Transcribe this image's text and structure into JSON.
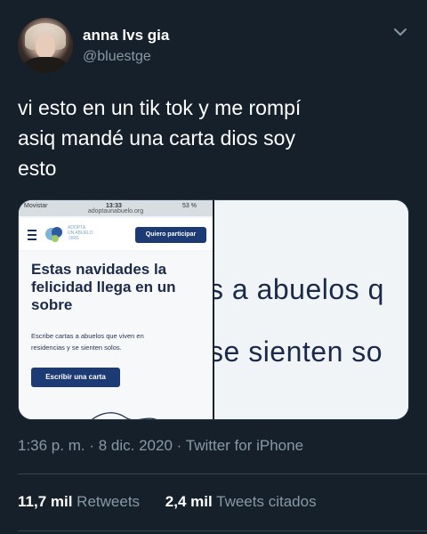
{
  "author": {
    "name": "anna lvs gia",
    "handle": "@bluestge"
  },
  "tweet": {
    "text": "vi esto en un tik tok y me rompí\nasiq mandé una carta dios soy\nesto"
  },
  "media": {
    "status_carrier": "Movistar",
    "status_time": "13:33",
    "status_battery": "53 %",
    "url": "adoptaunabuelo.org",
    "logo_text": "ADOPTA\nUN ABUELO\n.ORG",
    "header_cta": "Quiero participar",
    "hero_title": "Estas navidades la\nfelicidad llega en un\nsobre",
    "hero_desc": "Escribe cartas a abuelos que viven en\nresidencias y se sienten solos.",
    "hero_button": "Escribir una carta",
    "zoom_line1": "s a abuelos q",
    "zoom_line2": "se sienten so"
  },
  "meta": {
    "time": "1:36 p. m.",
    "date": "8 dic. 2020",
    "source": "Twitter for iPhone",
    "separator": "·"
  },
  "stats": {
    "retweets_count": "11,7 mil",
    "retweets_label": "Retweets",
    "quotes_count": "2,4 mil",
    "quotes_label": "Tweets citados"
  },
  "colors": {
    "background": "#15202b",
    "secondary_text": "#8899a6",
    "brand_navy": "#1c3a73"
  }
}
